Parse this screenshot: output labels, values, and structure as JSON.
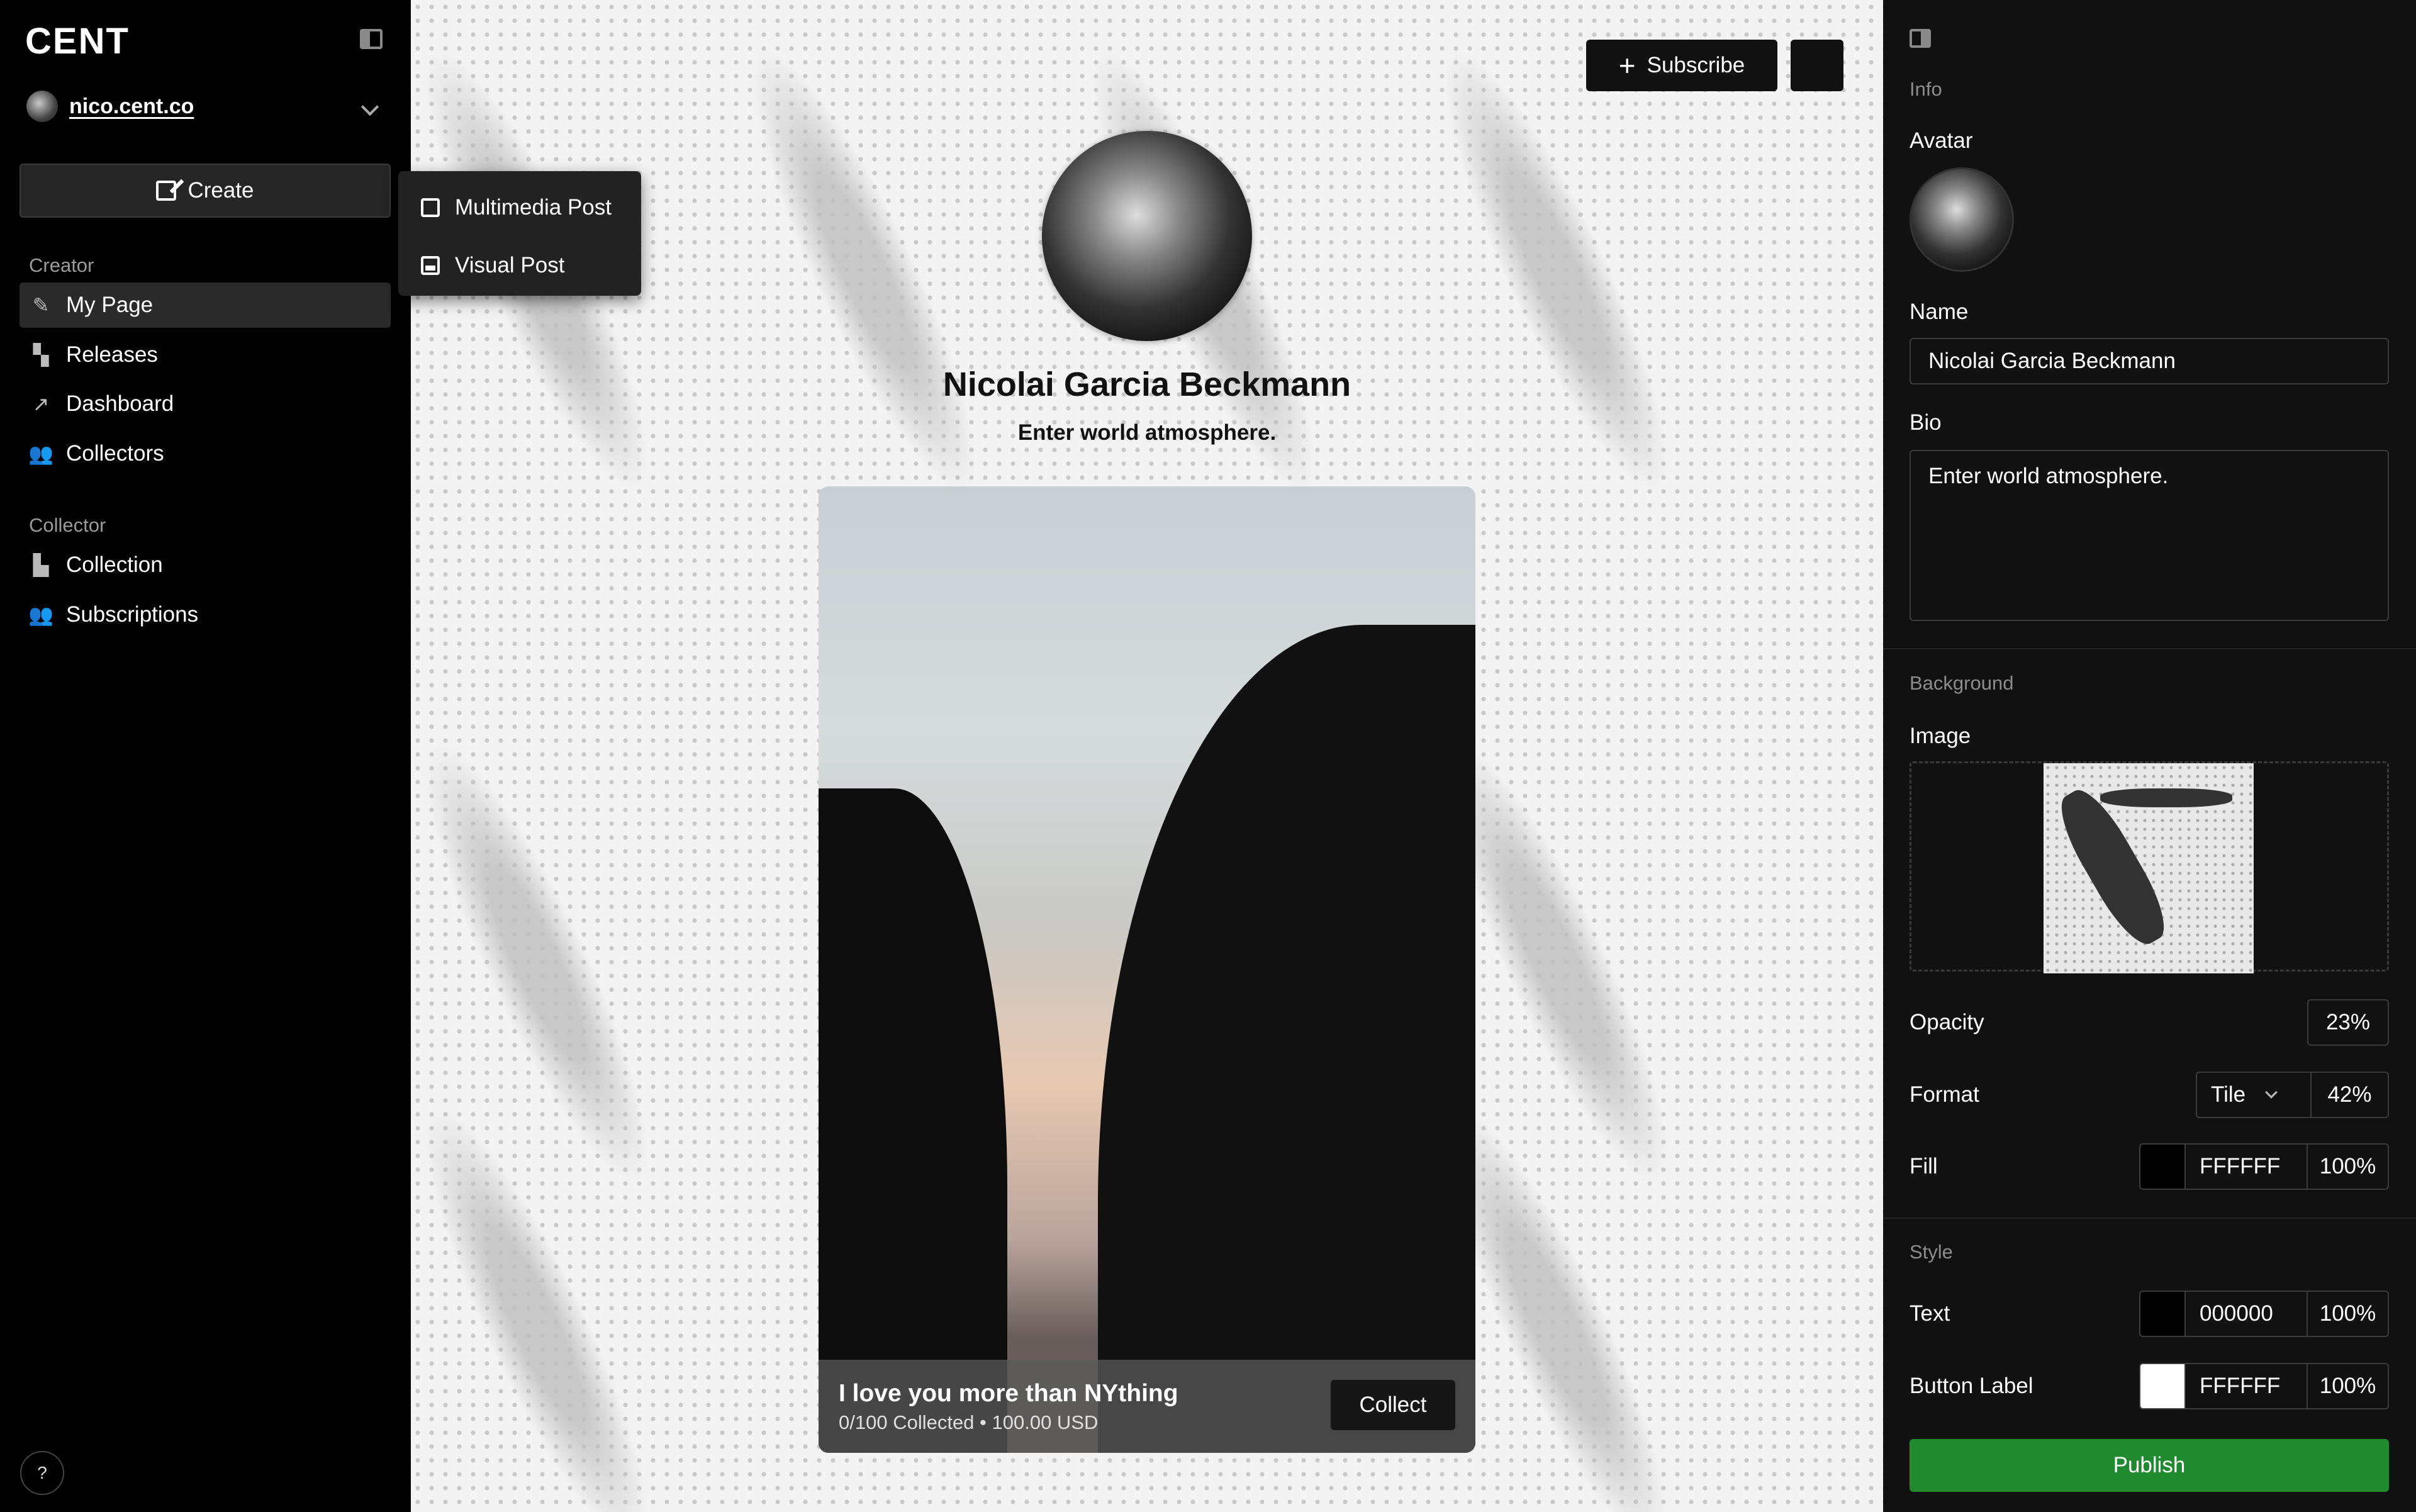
{
  "app": {
    "logo": "CENT"
  },
  "account": {
    "handle": "nico.cent.co"
  },
  "sidebar": {
    "create_label": "Create",
    "creator_section": "Creator",
    "creator_items": [
      {
        "label": "My Page",
        "icon": "brush-icon"
      },
      {
        "label": "Releases",
        "icon": "releases-icon"
      },
      {
        "label": "Dashboard",
        "icon": "trend-icon"
      },
      {
        "label": "Collectors",
        "icon": "users-icon"
      }
    ],
    "collector_section": "Collector",
    "collector_items": [
      {
        "label": "Collection",
        "icon": "collection-icon"
      },
      {
        "label": "Subscriptions",
        "icon": "users-icon"
      }
    ],
    "help_label": "?"
  },
  "create_menu": {
    "items": [
      {
        "label": "Multimedia Post",
        "icon": "edit-icon"
      },
      {
        "label": "Visual Post",
        "icon": "image-icon"
      }
    ]
  },
  "page": {
    "subscribe_label": "Subscribe",
    "profile_name": "Nicolai Garcia Beckmann",
    "bio": "Enter world atmosphere.",
    "post": {
      "title": "I love you more than NYthing",
      "meta": "0/100 Collected • 100.00 USD",
      "collect_label": "Collect"
    }
  },
  "panel": {
    "info_section": "Info",
    "avatar_label": "Avatar",
    "name_label": "Name",
    "name_value": "Nicolai Garcia Beckmann",
    "bio_label": "Bio",
    "bio_value": "Enter world atmosphere.",
    "background_section": "Background",
    "image_label": "Image",
    "opacity_label": "Opacity",
    "opacity_value": "23%",
    "format_label": "Format",
    "format_value": "Tile",
    "format_scale": "42%",
    "fill_label": "Fill",
    "fill_hex": "FFFFFF",
    "fill_opacity": "100%",
    "style_section": "Style",
    "text_label": "Text",
    "text_hex": "000000",
    "text_opacity": "100%",
    "button_label_label": "Button Label",
    "button_label_hex": "FFFFFF",
    "button_label_opacity": "100%",
    "publish_label": "Publish"
  },
  "colors": {
    "publish_green": "#1f8a2e",
    "canvas_bg": "#f3f3f3",
    "sidebar_bg": "#000000",
    "panel_bg": "#111111"
  }
}
